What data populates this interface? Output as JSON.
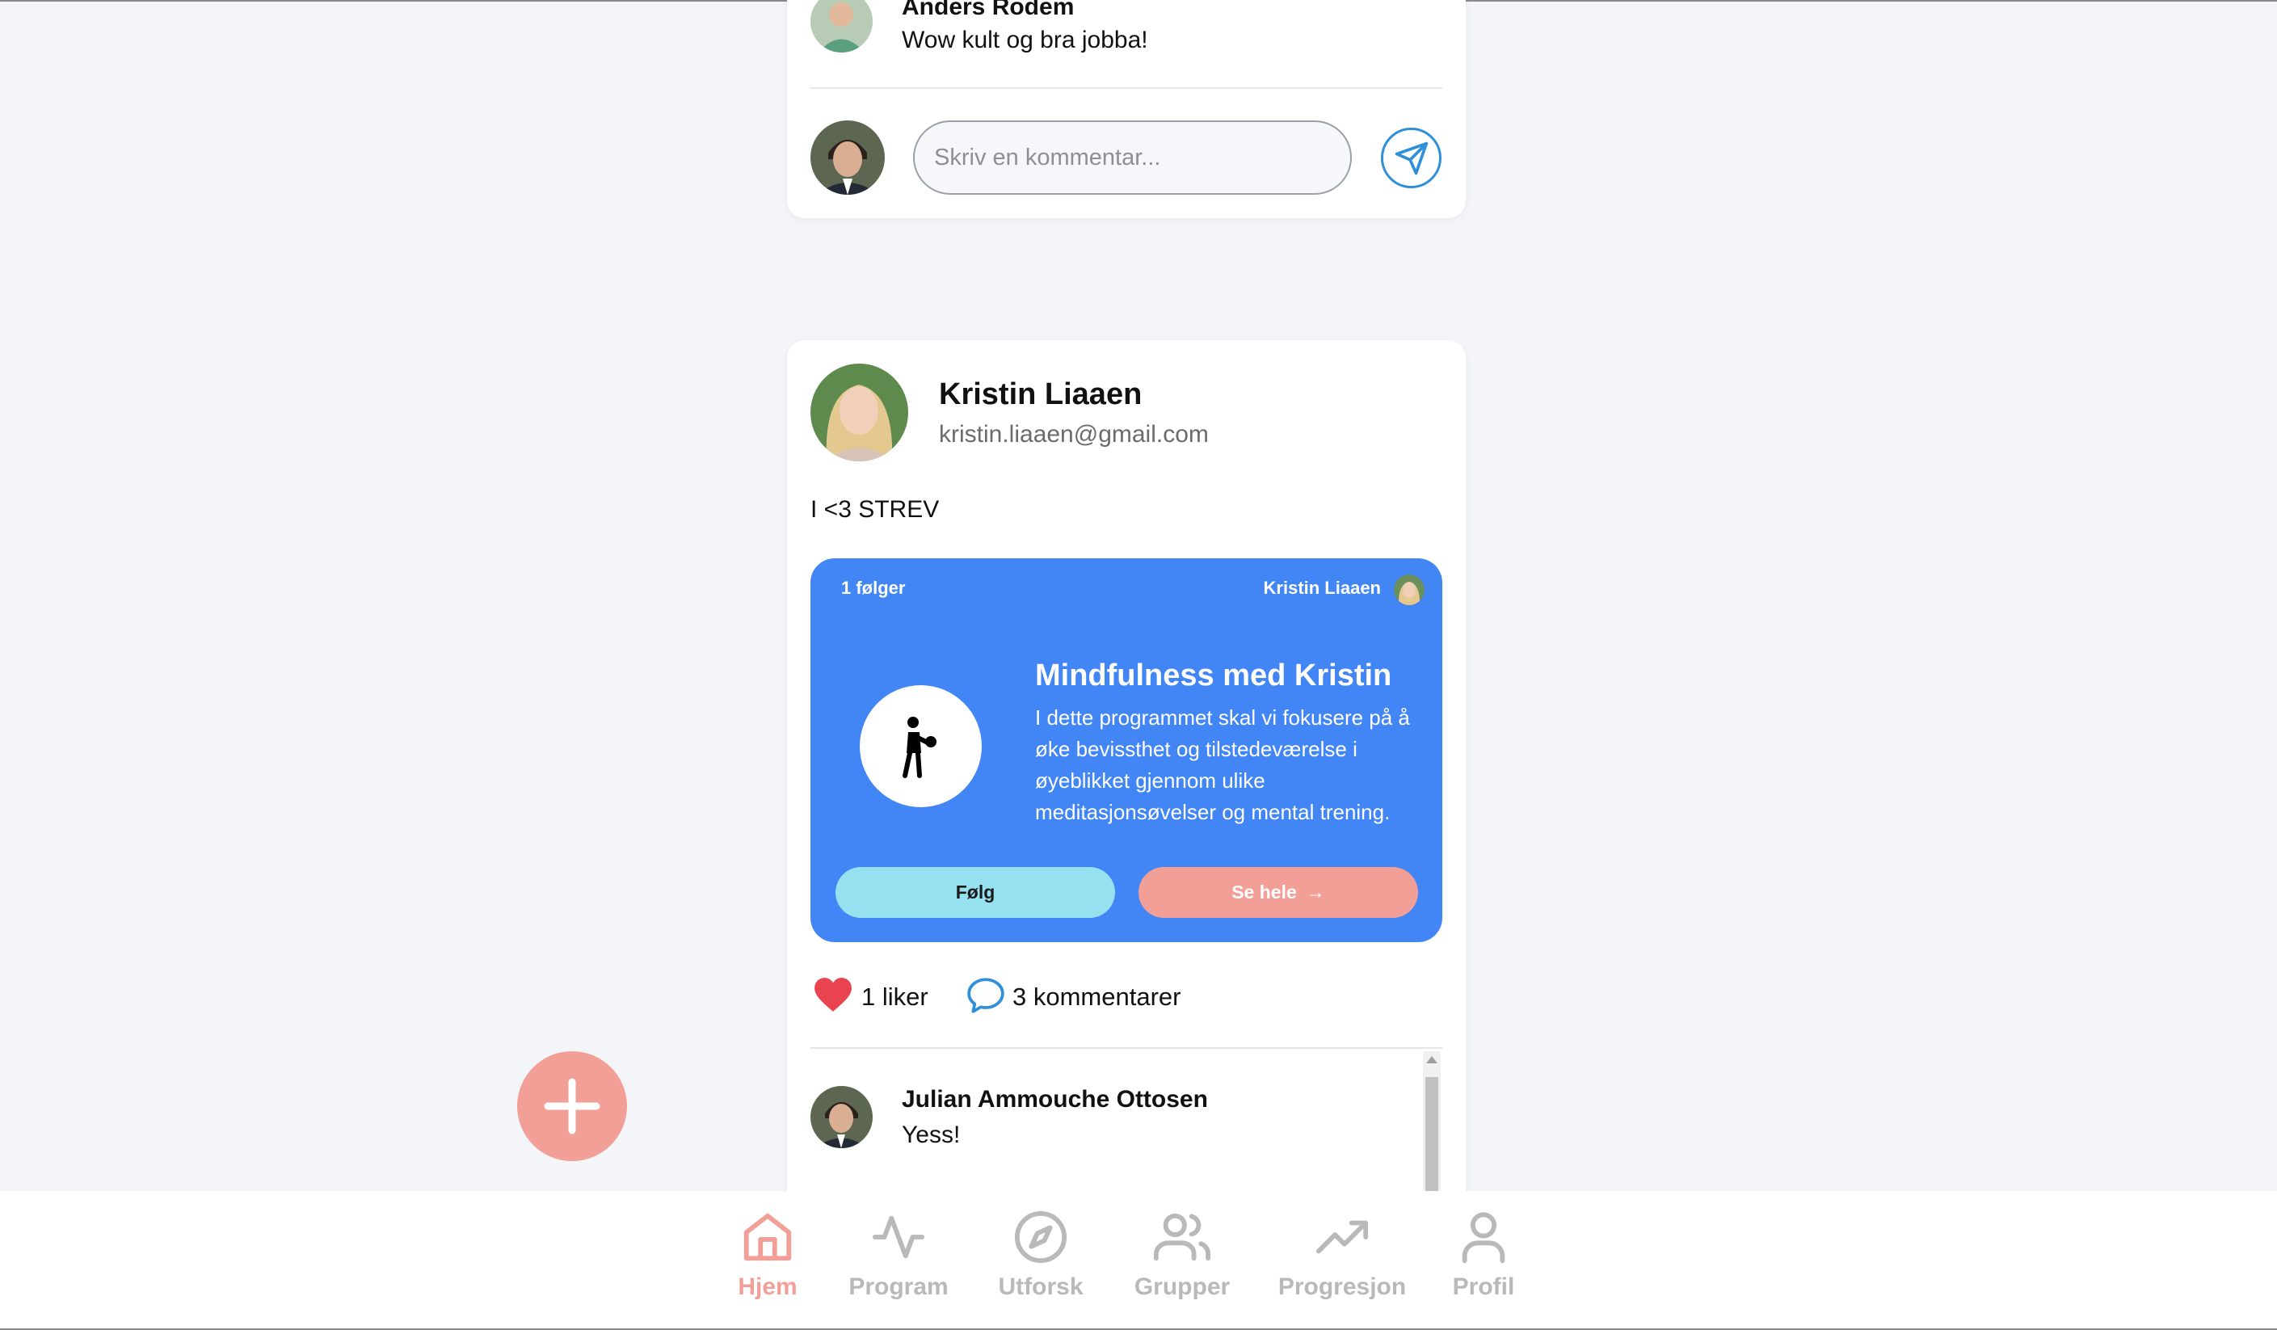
{
  "previous_post": {
    "last_comment": {
      "author": "Anders Rodem",
      "text": "Wow kult og bra jobba!"
    },
    "comment_placeholder": "Skriv en kommentar..."
  },
  "post": {
    "author_name": "Kristin Liaaen",
    "author_email": "kristin.liaaen@gmail.com",
    "text": "I <3 STREV",
    "program": {
      "followers": "1 følger",
      "owner": "Kristin Liaaen",
      "title": "Mindfulness med Kristin",
      "description": "I dette programmet skal vi fokusere på å øke bevissthet og tilstedeværelse i øyeblikket gjennom ulike meditasjonsøvelser og mental trening.",
      "follow_label": "Følg",
      "see_all_label": "Se hele",
      "card_color": "#4285f4"
    },
    "likes_label": "1 liker",
    "comments_label": "3 kommentarer",
    "comments": [
      {
        "author": "Julian Ammouche Ottosen",
        "text": "Yess!"
      }
    ]
  },
  "nav": {
    "items": [
      {
        "label": "Hjem",
        "icon": "home-icon",
        "active": true
      },
      {
        "label": "Program",
        "icon": "activity-icon"
      },
      {
        "label": "Utforsk",
        "icon": "compass-icon"
      },
      {
        "label": "Grupper",
        "icon": "users-icon"
      },
      {
        "label": "Progresjon",
        "icon": "trending-up-icon"
      },
      {
        "label": "Profil",
        "icon": "user-icon"
      }
    ]
  },
  "colors": {
    "accent": "#f29f97",
    "follow_button": "#96e1ef",
    "send_icon": "#2f8fd8",
    "heart": "#e8434f",
    "nav_inactive": "#b9b9b9"
  }
}
